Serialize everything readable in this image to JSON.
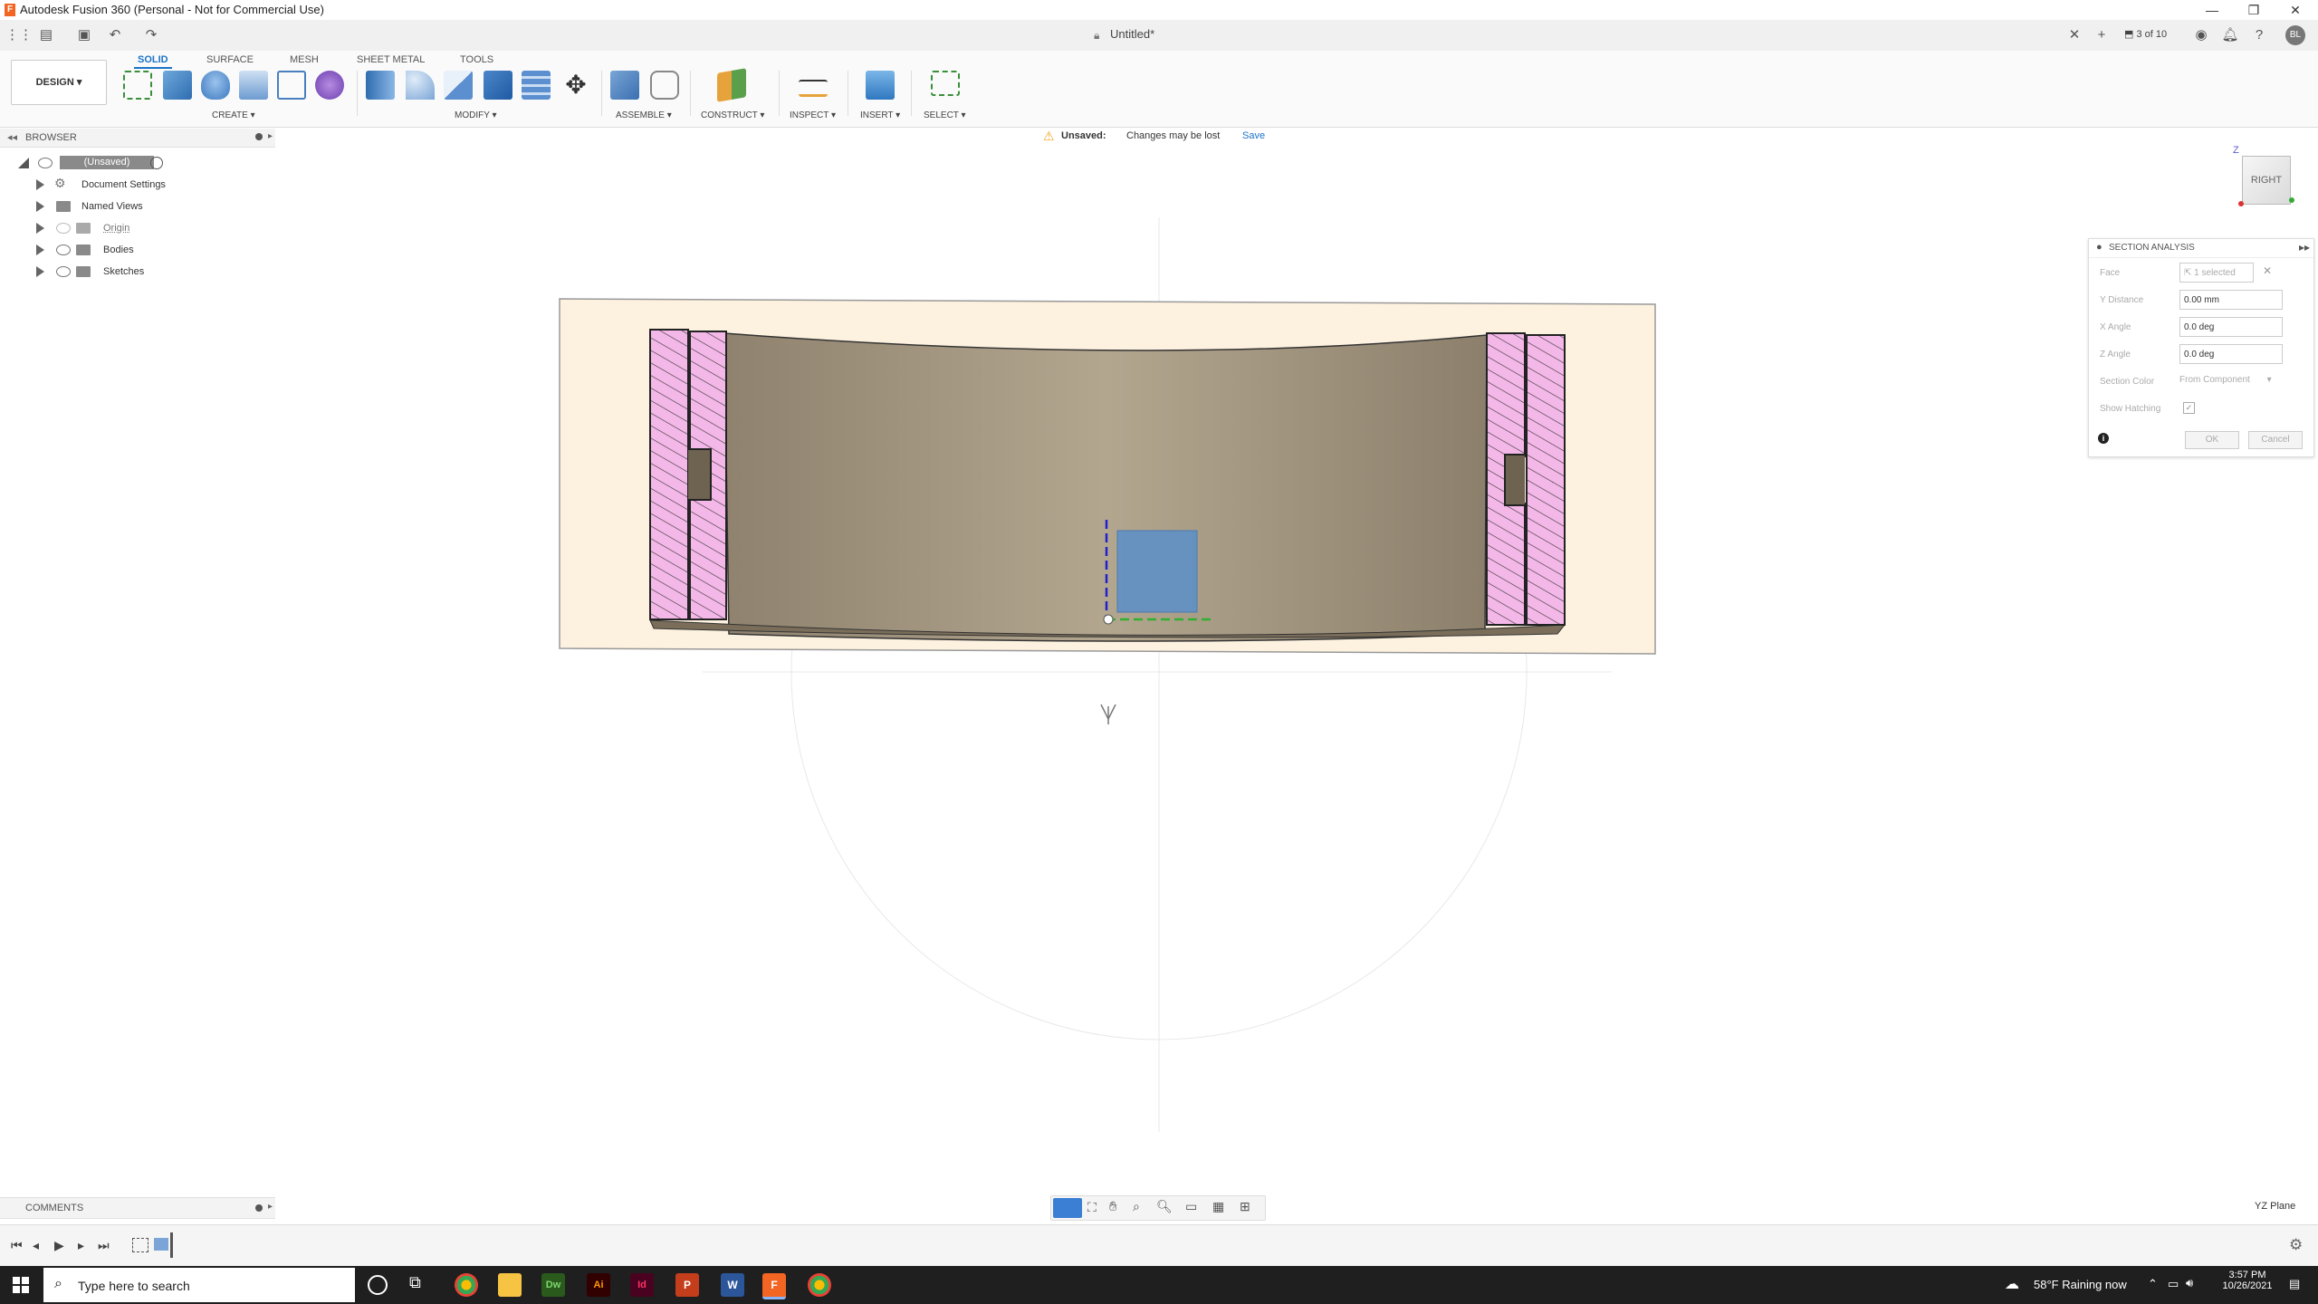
{
  "window": {
    "title": "Autodesk Fusion 360 (Personal - Not for Commercial Use)",
    "controls": [
      "—",
      "❐",
      "✕"
    ]
  },
  "tabbar": {
    "doc_title": "Untitled*",
    "job_status": "3 of 10",
    "user_initials": "BL"
  },
  "toolbar": {
    "workspace": "DESIGN ▾",
    "tabs": [
      "SOLID",
      "SURFACE",
      "MESH",
      "SHEET METAL",
      "TOOLS"
    ],
    "active_tab": "SOLID",
    "groups": [
      "CREATE ▾",
      "MODIFY ▾",
      "ASSEMBLE ▾",
      "CONSTRUCT ▾",
      "INSPECT ▾",
      "INSERT ▾",
      "SELECT ▾"
    ]
  },
  "browser": {
    "header": "BROWSER",
    "root": "(Unsaved)",
    "items": [
      "Document Settings",
      "Named Views",
      "Origin",
      "Bodies",
      "Sketches"
    ]
  },
  "banner": {
    "label": "Unsaved:",
    "message": "Changes may be lost",
    "save": "Save"
  },
  "viewcube": {
    "face": "RIGHT",
    "axis": "Z"
  },
  "section_analysis": {
    "title": "SECTION ANALYSIS",
    "fields": [
      {
        "label": "Face",
        "value": "1 selected"
      },
      {
        "label": "Y Distance",
        "value": "0.00 mm"
      },
      {
        "label": "X Angle",
        "value": "0.0 deg"
      },
      {
        "label": "Z Angle",
        "value": "0.0 deg"
      },
      {
        "label": "Section Color",
        "value": "From Component"
      },
      {
        "label": "Show Hatching",
        "value": ""
      }
    ],
    "ok": "OK",
    "cancel": "Cancel"
  },
  "status": {
    "comments": "COMMENTS",
    "plane": "YZ Plane"
  },
  "taskbar": {
    "search_placeholder": "Type here to search",
    "weather": "58°F  Raining now",
    "time": "3:57 PM",
    "date": "10/26/2021"
  },
  "colors": {
    "accent": "#1a73c8",
    "hatch": "#f4b8e8",
    "body": "#a0917a",
    "plane": "#fdf1df",
    "warning": "#f5a623"
  }
}
